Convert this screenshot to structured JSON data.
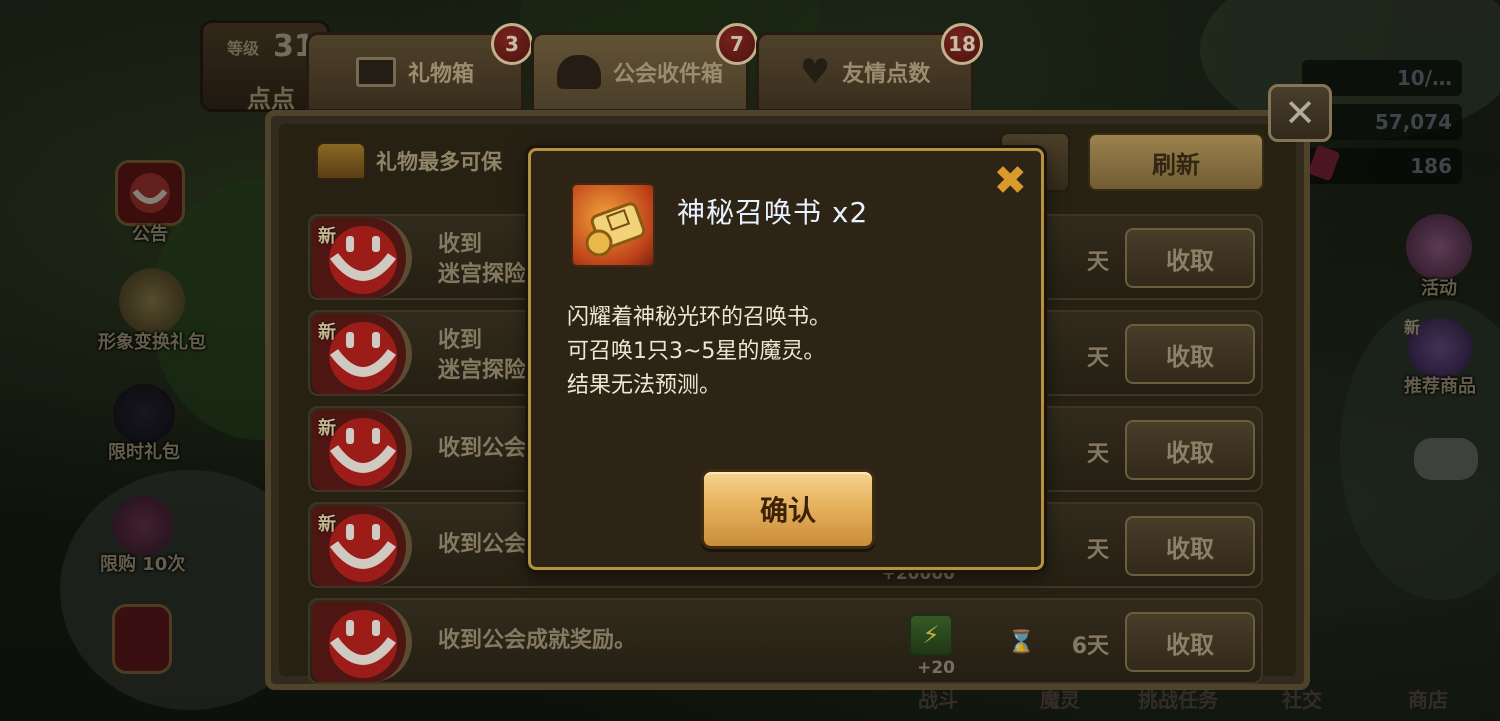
{
  "player": {
    "level_label": "等级",
    "level": "31",
    "name": "点点"
  },
  "resources": [
    "10/…",
    "57,074",
    "186"
  ],
  "left_menu": [
    "公告",
    "形象变换礼包",
    "限时礼包",
    "限购 10次"
  ],
  "right_menu": [
    "活动",
    "推荐商品"
  ],
  "right_menu_new_badge": "新",
  "bottom_bar": [
    "战斗",
    "魔灵",
    "挑战任务",
    "社交",
    "商店"
  ],
  "tabs": [
    {
      "label": "礼物箱",
      "count": "3",
      "icon": "gift-box-icon"
    },
    {
      "label": "公会收件箱",
      "count": "7",
      "icon": "guild-icon"
    },
    {
      "label": "友情点数",
      "count": "18",
      "icon": "heart-icon"
    }
  ],
  "storage_note": "礼物最多可保",
  "refresh_label": "刷新",
  "claim_label": "收取",
  "new_badge": "新",
  "rows": [
    {
      "line1": "收到",
      "line2": "迷宫探险",
      "is_new": true,
      "days": "天"
    },
    {
      "line1": "收到",
      "line2": "迷宫探险",
      "is_new": true,
      "days": "天"
    },
    {
      "line1": "收到公会",
      "line2": "",
      "is_new": true,
      "days": "天"
    },
    {
      "line1": "收到公会",
      "line2": "",
      "is_new": true,
      "days": "天",
      "reward_amount": "+20000"
    },
    {
      "line1": "收到公会成就奖励。",
      "line2": "",
      "is_new": false,
      "days": "6天",
      "reward_amount": "+20"
    }
  ],
  "modal": {
    "title": "神秘召唤书 x2",
    "desc_lines": [
      "闪耀着神秘光环的召唤书。",
      "可召唤1只3~5星的魔灵。",
      "结果无法预测。"
    ],
    "confirm_label": "确认",
    "close_icon": "close-icon"
  },
  "colors": {
    "modal_border": "#b4923f",
    "confirm_button": "#e6b25e",
    "badge": "#8e2a22"
  }
}
